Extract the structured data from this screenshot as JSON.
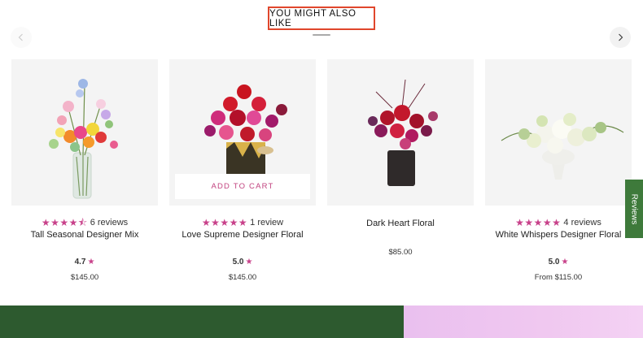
{
  "section": {
    "title": "YOU MIGHT ALSO LIKE"
  },
  "nav": {
    "prev_icon": "chevron-left-icon",
    "next_icon": "chevron-right-icon"
  },
  "products": [
    {
      "name": "Tall Seasonal Designer Mix",
      "stars": "★★★★⯪",
      "reviews": "6 reviews",
      "score": "4.7",
      "price": "$145.00"
    },
    {
      "name": "Love Supreme Designer Floral",
      "stars": "★★★★★",
      "reviews": "1 review",
      "score": "5.0",
      "price": "$145.00",
      "add_to_cart": "ADD TO CART"
    },
    {
      "name": "Dark Heart Floral",
      "price": "$85.00"
    },
    {
      "name": "White Whispers Designer Floral",
      "stars": "★★★★★",
      "reviews": "4 reviews",
      "score": "5.0",
      "price": "From $115.00"
    }
  ],
  "score_star": "★",
  "reviews_tab": {
    "label": "Reviews"
  },
  "colors": {
    "accent": "#c8418a",
    "title_border": "#e0462c",
    "green": "#2d5a2f",
    "pink": "#eac0ef",
    "tab": "#3e7a3b"
  }
}
